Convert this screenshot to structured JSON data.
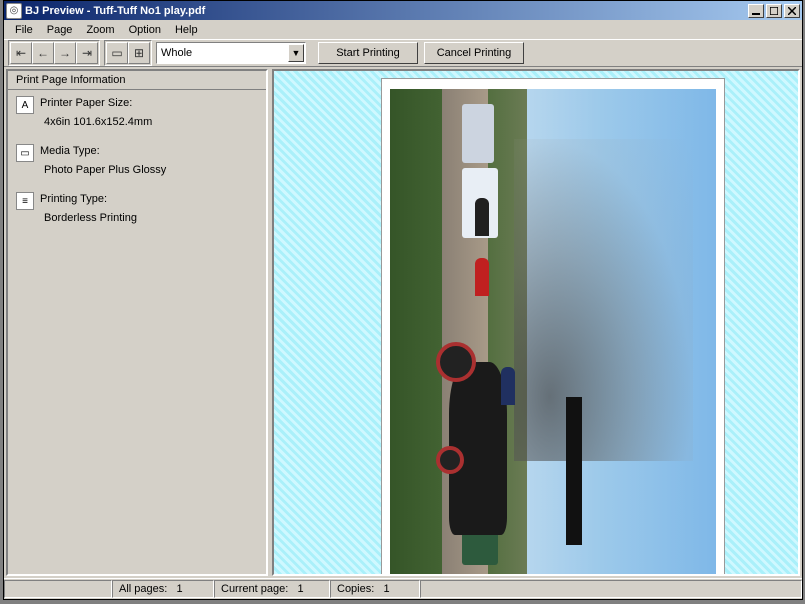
{
  "window": {
    "title": "BJ Preview - Tuff-Tuff No1 play.pdf"
  },
  "menubar": {
    "items": [
      "File",
      "Page",
      "Zoom",
      "Option",
      "Help"
    ]
  },
  "toolbar": {
    "zoom_value": "Whole",
    "start_printing": "Start Printing",
    "cancel_printing": "Cancel Printing"
  },
  "sidebar": {
    "header": "Print Page Information",
    "paper_size_label": "Printer Paper Size:",
    "paper_size_value": "4x6in 101.6x152.4mm",
    "media_type_label": "Media Type:",
    "media_type_value": "Photo Paper Plus Glossy",
    "printing_type_label": "Printing Type:",
    "printing_type_value": "Borderless Printing"
  },
  "statusbar": {
    "all_pages_label": "All pages:",
    "all_pages_value": "1",
    "current_page_label": "Current page:",
    "current_page_value": "1",
    "copies_label": "Copies:",
    "copies_value": "1"
  }
}
